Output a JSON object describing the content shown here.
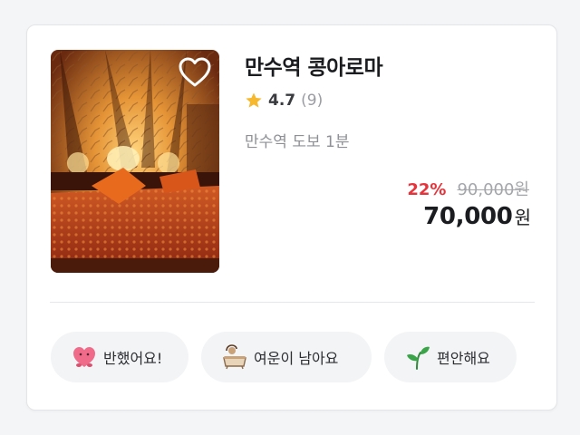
{
  "listing": {
    "name": "만수역 콩아로마",
    "rating": "4.7",
    "review_count": "(9)",
    "location": "만수역 도보 1분",
    "discount": "22%",
    "original_price": "90,000원",
    "price": "70,000",
    "price_unit": "원",
    "favorite": false
  },
  "chips": [
    {
      "icon": "pink-heart-character-icon",
      "label": "반했어요!"
    },
    {
      "icon": "bathtub-icon",
      "label": "여운이 남아요"
    },
    {
      "icon": "sprout-icon",
      "label": "편안해요"
    }
  ],
  "colors": {
    "discount": "#e5343b",
    "star": "#f5b82e",
    "chip_background": "#f3f4f6"
  }
}
